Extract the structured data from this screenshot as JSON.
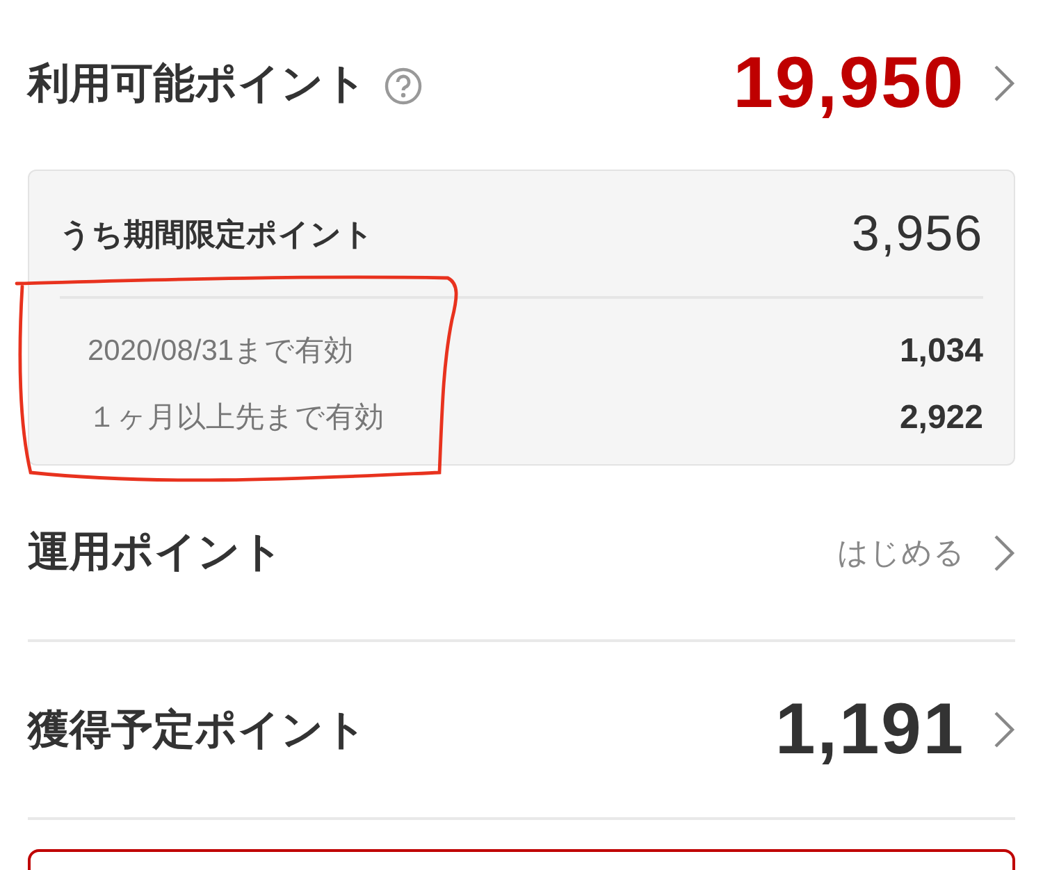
{
  "available_points": {
    "label": "利用可能ポイント",
    "value": "19,950"
  },
  "limited_points": {
    "label": "うち期間限定ポイント",
    "value": "3,956",
    "breakdown": [
      {
        "label": "2020/08/31まで有効",
        "value": "1,034"
      },
      {
        "label": "１ヶ月以上先まで有効",
        "value": "2,922"
      }
    ]
  },
  "investment_points": {
    "label": "運用ポイント",
    "action": "はじめる"
  },
  "pending_points": {
    "label": "獲得予定ポイント",
    "value": "1,191"
  }
}
